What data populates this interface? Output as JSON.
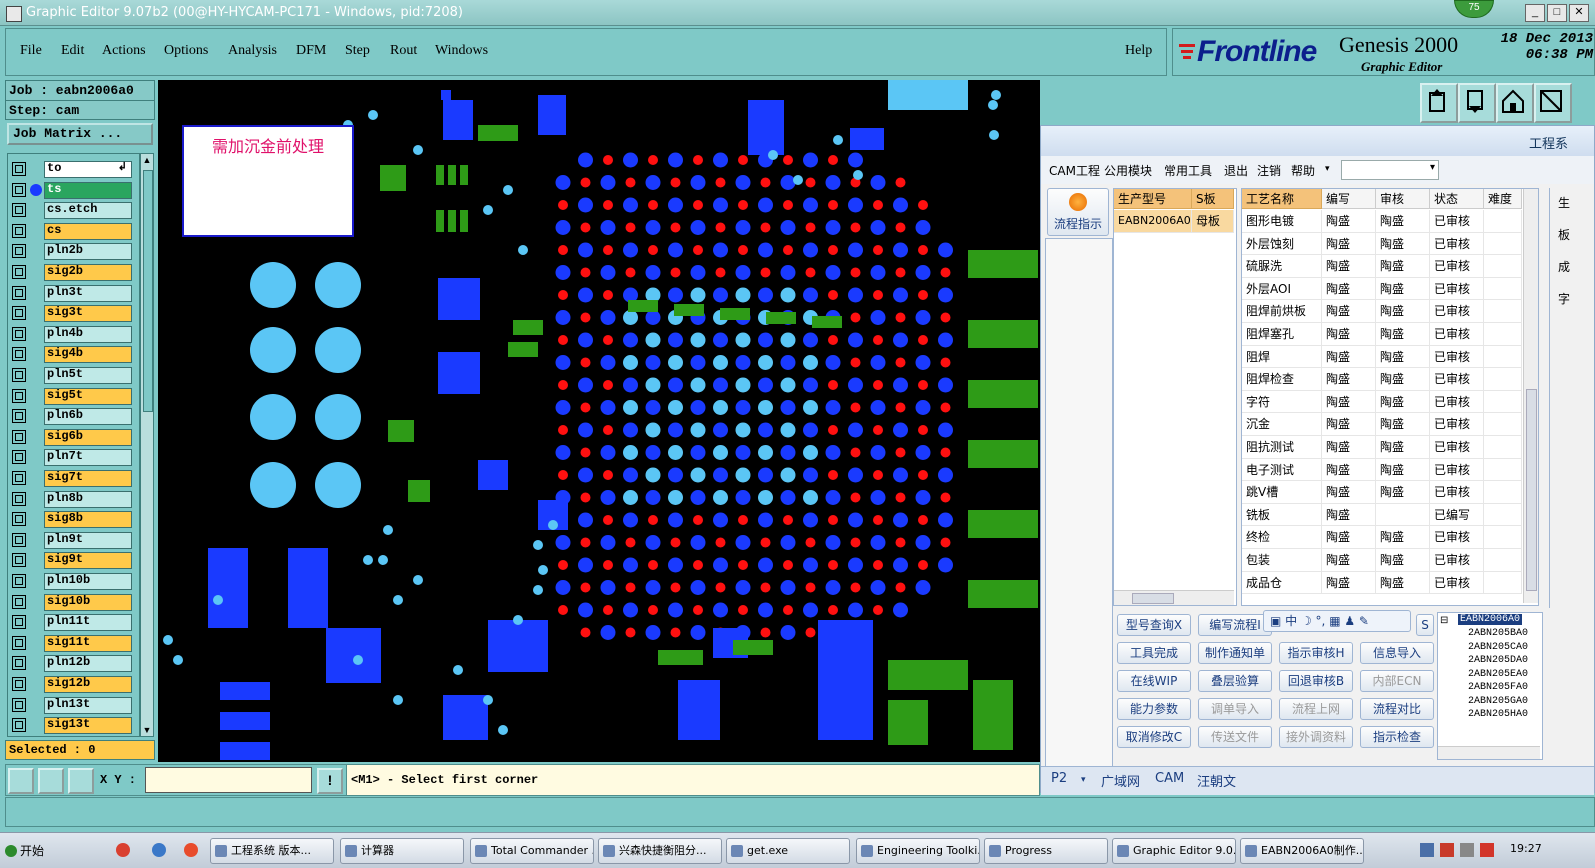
{
  "window": {
    "title": "Graphic Editor 9.07b2 (00@HY-HYCAM-PC171 - Windows, pid:7208)",
    "badge": "75",
    "controls": [
      "_",
      "□",
      "✕"
    ]
  },
  "menu": {
    "items": [
      "File",
      "Edit",
      "Actions",
      "Options",
      "Analysis",
      "DFM",
      "Step",
      "Rout",
      "Windows"
    ],
    "help": "Help"
  },
  "brand": {
    "logo": "Frontline",
    "product": "Genesis 2000",
    "subtitle": "Graphic Editor",
    "date": "18 Dec 2013",
    "time": "06:38 PM"
  },
  "job": {
    "job_line": "Job : eabn2006a0",
    "step_line": "Step: cam",
    "matrix_button": "Job Matrix ..."
  },
  "layers": [
    {
      "name": "to",
      "style": "white"
    },
    {
      "name": "ts",
      "style": "green"
    },
    {
      "name": "cs.etch",
      "style": "pln"
    },
    {
      "name": "cs",
      "style": "sig"
    },
    {
      "name": "pln2b",
      "style": "pln"
    },
    {
      "name": "sig2b",
      "style": "sig"
    },
    {
      "name": "pln3t",
      "style": "pln"
    },
    {
      "name": "sig3t",
      "style": "sig"
    },
    {
      "name": "pln4b",
      "style": "pln"
    },
    {
      "name": "sig4b",
      "style": "sig"
    },
    {
      "name": "pln5t",
      "style": "pln"
    },
    {
      "name": "sig5t",
      "style": "sig"
    },
    {
      "name": "pln6b",
      "style": "pln"
    },
    {
      "name": "sig6b",
      "style": "sig"
    },
    {
      "name": "pln7t",
      "style": "pln"
    },
    {
      "name": "sig7t",
      "style": "sig"
    },
    {
      "name": "pln8b",
      "style": "pln"
    },
    {
      "name": "sig8b",
      "style": "sig"
    },
    {
      "name": "pln9t",
      "style": "pln"
    },
    {
      "name": "sig9t",
      "style": "sig"
    },
    {
      "name": "pln10b",
      "style": "pln"
    },
    {
      "name": "sig10b",
      "style": "sig"
    },
    {
      "name": "pln11t",
      "style": "pln"
    },
    {
      "name": "sig11t",
      "style": "sig"
    },
    {
      "name": "pln12b",
      "style": "pln"
    },
    {
      "name": "sig12b",
      "style": "sig"
    },
    {
      "name": "pln13t",
      "style": "pln"
    },
    {
      "name": "sig13t",
      "style": "sig"
    }
  ],
  "selected": "Selected : 0",
  "canvas_note": "需加沉金前处理",
  "command": {
    "xy_label": "X Y :",
    "xy_value": "",
    "prompt": "<M1> - Select first corner"
  },
  "cam_dialog": {
    "title": "工程系",
    "menu": [
      "CAM工程",
      "公用模块",
      "常用工具",
      "退出",
      "注销",
      "帮助"
    ],
    "flow_button": "流程指示",
    "model_headers": [
      "生产型号",
      "S板"
    ],
    "model_row": [
      "EABN2006A0",
      "母板"
    ],
    "process_headers": [
      "工艺名称",
      "编写",
      "审核",
      "状态",
      "难度"
    ],
    "processes": [
      [
        "图形电镀",
        "陶盛",
        "陶盛",
        "已审核",
        ""
      ],
      [
        "外层蚀刻",
        "陶盛",
        "陶盛",
        "已审核",
        ""
      ],
      [
        "硫脲洗",
        "陶盛",
        "陶盛",
        "已审核",
        ""
      ],
      [
        "外层AOI",
        "陶盛",
        "陶盛",
        "已审核",
        ""
      ],
      [
        "阻焊前烘板",
        "陶盛",
        "陶盛",
        "已审核",
        ""
      ],
      [
        "阻焊塞孔",
        "陶盛",
        "陶盛",
        "已审核",
        ""
      ],
      [
        "阻焊",
        "陶盛",
        "陶盛",
        "已审核",
        ""
      ],
      [
        "阻焊检查",
        "陶盛",
        "陶盛",
        "已审核",
        ""
      ],
      [
        "字符",
        "陶盛",
        "陶盛",
        "已审核",
        ""
      ],
      [
        "沉金",
        "陶盛",
        "陶盛",
        "已审核",
        ""
      ],
      [
        "阻抗测试",
        "陶盛",
        "陶盛",
        "已审核",
        ""
      ],
      [
        "电子测试",
        "陶盛",
        "陶盛",
        "已审核",
        ""
      ],
      [
        "跳V槽",
        "陶盛",
        "陶盛",
        "已审核",
        ""
      ],
      [
        "铣板",
        "陶盛",
        "",
        "已编写",
        ""
      ],
      [
        "终检",
        "陶盛",
        "陶盛",
        "已审核",
        ""
      ],
      [
        "包装",
        "陶盛",
        "陶盛",
        "已审核",
        ""
      ],
      [
        "成品仓",
        "陶盛",
        "陶盛",
        "已审核",
        ""
      ]
    ],
    "buttons": [
      {
        "label": "型号查询X",
        "enabled": true
      },
      {
        "label": "编写流程I",
        "enabled": true
      },
      {
        "label": "S",
        "enabled": true
      },
      {
        "label": "工具完成",
        "enabled": true
      },
      {
        "label": "制作通知单",
        "enabled": true
      },
      {
        "label": "指示审核H",
        "enabled": true
      },
      {
        "label": "信息导入",
        "enabled": true
      },
      {
        "label": "在线WIP",
        "enabled": true
      },
      {
        "label": "叠层验算",
        "enabled": true
      },
      {
        "label": "回退审核B",
        "enabled": true
      },
      {
        "label": "内部ECN",
        "enabled": false
      },
      {
        "label": "能力参数",
        "enabled": true
      },
      {
        "label": "调单导入",
        "enabled": false
      },
      {
        "label": "流程上网",
        "enabled": false
      },
      {
        "label": "流程对比",
        "enabled": true
      },
      {
        "label": "取消修改C",
        "enabled": true
      },
      {
        "label": "传送文件",
        "enabled": false
      },
      {
        "label": "接外调资料",
        "enabled": false
      },
      {
        "label": "指示检查",
        "enabled": true
      }
    ],
    "ime_bar": "中",
    "tree": {
      "root": "EABN2006A0",
      "children": [
        "2ABN205BA0",
        "2ABN205CA0",
        "2ABN205DA0",
        "2ABN205EA0",
        "2ABN205FA0",
        "2ABN205GA0",
        "2ABN205HA0"
      ]
    },
    "side_labels": [
      "生",
      "板",
      "成",
      "字"
    ],
    "tabs": [
      "P2",
      "广域网",
      "CAM",
      "汪朝文"
    ]
  },
  "taskbar": {
    "start": "开始",
    "tasks": [
      "工程系统 版本...",
      "计算器",
      "Total Commander ...",
      "兴森快捷衡阻分...",
      "get.exe",
      "Engineering Toolki...",
      "Progress",
      "Graphic Editor 9.0...",
      "EABN2006A0制作..."
    ],
    "clock": "19:27"
  },
  "colors": {
    "pad_blue": "#1a3aff",
    "pad_cyan": "#5bc6f5",
    "pad_red": "#ff1010",
    "pad_green": "#2e9b17",
    "panel_teal": "#7fc9c7",
    "sig_orange": "#ffc94a"
  }
}
